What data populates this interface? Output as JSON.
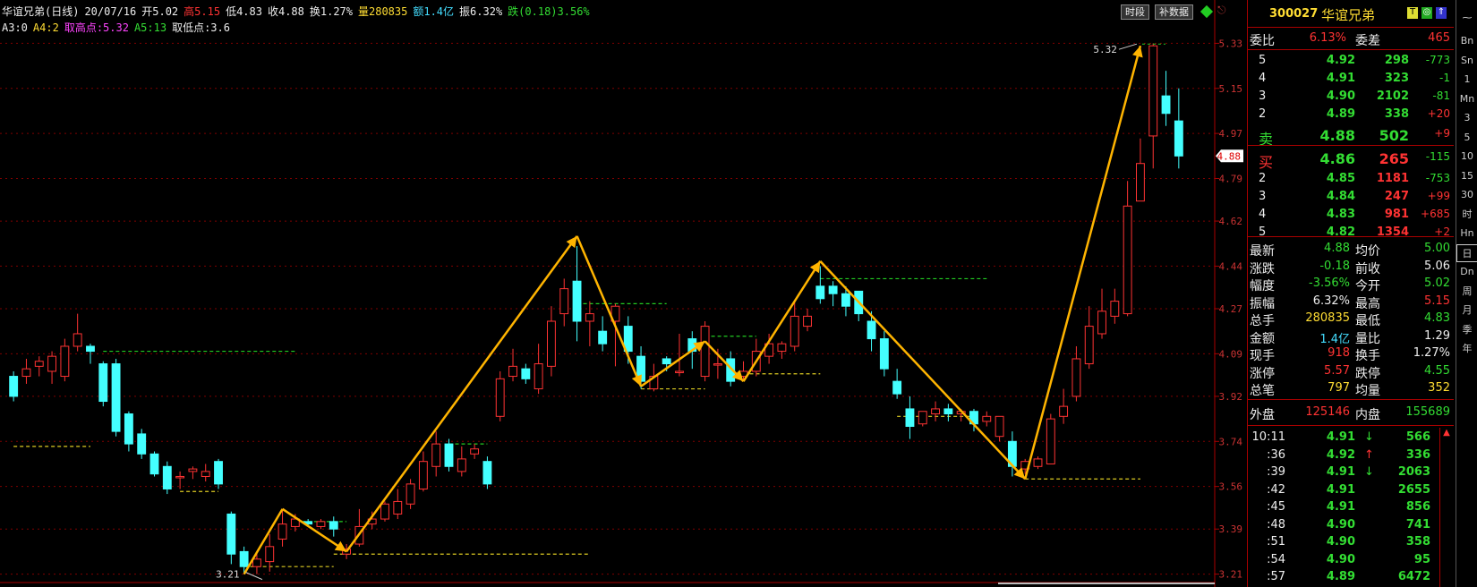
{
  "header": {
    "name": "华谊兄弟(日线)",
    "date": "20/07/16",
    "open": "开5.02",
    "high": "高5.15",
    "low": "低4.83",
    "close": "收4.88",
    "turnover": "换1.27%",
    "volume": "量280835",
    "amount": "额1.4亿",
    "amplitude": "振6.32%",
    "change": "跌(0.18)3.56%"
  },
  "indicator": {
    "a3": "A3:0",
    "a4": "A4:2",
    "high_pt": "取高点:5.32",
    "a5": "A5:13",
    "low_pt": "取低点:3.6"
  },
  "buttons": {
    "timeshare": "时段",
    "fill_data": "补数据"
  },
  "colors": {
    "up": "#ff3333",
    "down": "#44ffff",
    "arrow": "#ffb400",
    "grid": "#800000"
  },
  "chart_data": {
    "type": "candlestick",
    "ylim": [
      3.18,
      5.36
    ],
    "y_ticks": [
      "5.33",
      "5.15",
      "4.97",
      "4.79",
      "4.62",
      "4.44",
      "4.27",
      "4.09",
      "3.92",
      "3.74",
      "3.56",
      "3.39",
      "3.21"
    ],
    "current_price_tag": "4.88",
    "max_label": "5.32",
    "min_label": "3.21",
    "candles": [
      [
        4.0,
        3.92,
        4.02,
        3.9
      ],
      [
        4.0,
        4.03,
        4.07,
        3.97
      ],
      [
        4.04,
        4.06,
        4.08,
        4.0
      ],
      [
        4.02,
        4.08,
        4.1,
        3.97
      ],
      [
        4.0,
        4.12,
        4.15,
        3.98
      ],
      [
        4.12,
        4.17,
        4.25,
        4.1
      ],
      [
        4.12,
        4.1,
        4.13,
        4.05
      ],
      [
        4.05,
        3.9,
        4.06,
        3.88
      ],
      [
        4.05,
        3.78,
        4.07,
        3.76
      ],
      [
        3.85,
        3.73,
        3.86,
        3.7
      ],
      [
        3.77,
        3.69,
        3.79,
        3.67
      ],
      [
        3.69,
        3.61,
        3.7,
        3.6
      ],
      [
        3.64,
        3.55,
        3.66,
        3.53
      ],
      [
        3.6,
        3.6,
        3.62,
        3.55
      ],
      [
        3.62,
        3.63,
        3.64,
        3.59
      ],
      [
        3.6,
        3.62,
        3.65,
        3.58
      ],
      [
        3.66,
        3.57,
        3.67,
        3.55
      ],
      [
        3.45,
        3.29,
        3.46,
        3.25
      ],
      [
        3.3,
        3.24,
        3.32,
        3.21
      ],
      [
        3.24,
        3.27,
        3.3,
        3.21
      ],
      [
        3.26,
        3.32,
        3.37,
        3.22
      ],
      [
        3.35,
        3.41,
        3.47,
        3.32
      ],
      [
        3.4,
        3.43,
        3.45,
        3.38
      ],
      [
        3.42,
        3.41,
        3.43,
        3.4
      ],
      [
        3.4,
        3.42,
        3.43,
        3.39
      ],
      [
        3.42,
        3.39,
        3.44,
        3.36
      ],
      [
        3.29,
        3.31,
        3.33,
        3.27
      ],
      [
        3.33,
        3.4,
        3.47,
        3.32
      ],
      [
        3.41,
        3.43,
        3.46,
        3.39
      ],
      [
        3.43,
        3.49,
        3.5,
        3.42
      ],
      [
        3.45,
        3.5,
        3.55,
        3.43
      ],
      [
        3.49,
        3.57,
        3.59,
        3.47
      ],
      [
        3.55,
        3.66,
        3.7,
        3.54
      ],
      [
        3.64,
        3.73,
        3.78,
        3.6
      ],
      [
        3.73,
        3.64,
        3.75,
        3.62
      ],
      [
        3.62,
        3.67,
        3.72,
        3.6
      ],
      [
        3.69,
        3.71,
        3.73,
        3.67
      ],
      [
        3.66,
        3.57,
        3.68,
        3.55
      ],
      [
        3.84,
        3.99,
        4.02,
        3.82
      ],
      [
        4.0,
        4.04,
        4.11,
        3.98
      ],
      [
        4.03,
        3.99,
        4.05,
        3.97
      ],
      [
        3.95,
        4.05,
        4.13,
        3.93
      ],
      [
        4.04,
        4.22,
        4.28,
        4.0
      ],
      [
        4.25,
        4.35,
        4.39,
        4.2
      ],
      [
        4.38,
        4.22,
        4.52,
        4.14
      ],
      [
        4.22,
        4.25,
        4.3,
        4.12
      ],
      [
        4.18,
        4.13,
        4.24,
        4.1
      ],
      [
        4.22,
        4.28,
        4.29,
        4.04
      ],
      [
        4.2,
        4.1,
        4.24,
        4.05
      ],
      [
        4.08,
        3.98,
        4.12,
        3.95
      ],
      [
        3.95,
        4.0,
        4.05,
        3.94
      ],
      [
        4.07,
        4.05,
        4.08,
        4.02
      ],
      [
        4.02,
        4.02,
        4.17,
        4.0
      ],
      [
        4.15,
        4.1,
        4.18,
        4.03
      ],
      [
        4.0,
        4.2,
        4.22,
        3.98
      ],
      [
        4.05,
        4.05,
        4.11,
        3.99
      ],
      [
        4.07,
        3.98,
        4.1,
        3.96
      ],
      [
        4.0,
        4.02,
        4.06,
        3.98
      ],
      [
        4.02,
        4.1,
        4.15,
        4.0
      ],
      [
        4.08,
        4.13,
        4.17,
        4.05
      ],
      [
        4.1,
        4.13,
        4.14,
        4.07
      ],
      [
        4.12,
        4.24,
        4.3,
        4.1
      ],
      [
        4.2,
        4.24,
        4.27,
        4.18
      ],
      [
        4.36,
        4.31,
        4.44,
        4.29
      ],
      [
        4.36,
        4.33,
        4.38,
        4.28
      ],
      [
        4.33,
        4.28,
        4.36,
        4.24
      ],
      [
        4.34,
        4.25,
        4.33,
        4.22
      ],
      [
        4.22,
        4.15,
        4.26,
        4.1
      ],
      [
        4.15,
        4.03,
        4.18,
        4.0
      ],
      [
        3.98,
        3.93,
        4.03,
        3.91
      ],
      [
        3.87,
        3.8,
        3.92,
        3.75
      ],
      [
        3.81,
        3.86,
        3.86,
        3.8
      ],
      [
        3.85,
        3.87,
        3.9,
        3.82
      ],
      [
        3.87,
        3.85,
        3.89,
        3.82
      ],
      [
        3.85,
        3.86,
        3.87,
        3.82
      ],
      [
        3.86,
        3.81,
        3.87,
        3.78
      ],
      [
        3.82,
        3.84,
        3.86,
        3.8
      ],
      [
        3.76,
        3.84,
        3.84,
        3.74
      ],
      [
        3.74,
        3.64,
        3.78,
        3.6
      ],
      [
        3.63,
        3.66,
        3.67,
        3.61
      ],
      [
        3.64,
        3.67,
        3.68,
        3.63
      ],
      [
        3.65,
        3.83,
        3.85,
        3.65
      ],
      [
        3.84,
        3.88,
        3.95,
        3.81
      ],
      [
        3.92,
        4.07,
        4.12,
        3.9
      ],
      [
        4.05,
        4.2,
        4.28,
        4.03
      ],
      [
        4.17,
        4.26,
        4.35,
        4.15
      ],
      [
        4.24,
        4.3,
        4.35,
        4.21
      ],
      [
        4.25,
        4.68,
        4.78,
        4.24
      ],
      [
        4.7,
        4.85,
        4.95,
        4.7
      ],
      [
        4.96,
        5.32,
        5.33,
        4.83
      ],
      [
        5.12,
        5.05,
        5.22,
        5.0
      ],
      [
        5.02,
        4.88,
        5.15,
        4.83
      ]
    ],
    "pivots": [
      [
        21,
        3.47
      ],
      [
        26,
        3.3
      ],
      [
        44,
        4.56
      ],
      [
        49,
        3.96
      ],
      [
        54,
        4.14
      ],
      [
        57,
        3.98
      ],
      [
        63,
        4.46
      ],
      [
        79,
        3.59
      ],
      [
        88,
        5.32
      ]
    ],
    "dashed_levels": [
      {
        "y": 4.1,
        "from": 7,
        "to": 22,
        "c": "g"
      },
      {
        "y": 3.72,
        "from": 0,
        "to": 6,
        "c": "y"
      },
      {
        "y": 3.54,
        "from": 13,
        "to": 16,
        "c": "y"
      },
      {
        "y": 3.24,
        "from": 18,
        "to": 25,
        "c": "y"
      },
      {
        "y": 3.29,
        "from": 25,
        "to": 45,
        "c": "y"
      },
      {
        "y": 3.42,
        "from": 22,
        "to": 26,
        "c": "g"
      },
      {
        "y": 3.73,
        "from": 34,
        "to": 37,
        "c": "g"
      },
      {
        "y": 4.29,
        "from": 44,
        "to": 51,
        "c": "g"
      },
      {
        "y": 3.95,
        "from": 49,
        "to": 54,
        "c": "y"
      },
      {
        "y": 4.16,
        "from": 54,
        "to": 58,
        "c": "g"
      },
      {
        "y": 4.01,
        "from": 57,
        "to": 63,
        "c": "y"
      },
      {
        "y": 4.39,
        "from": 63,
        "to": 76,
        "c": "g"
      },
      {
        "y": 3.84,
        "from": 69,
        "to": 75,
        "c": "y"
      },
      {
        "y": 3.59,
        "from": 79,
        "to": 88,
        "c": "y"
      }
    ]
  },
  "quote": {
    "code": "300027",
    "name": "华谊兄弟",
    "wb_label": "委比",
    "wb_value": "6.13%",
    "wc_label": "委差",
    "wc_value": "465",
    "sells": [
      {
        "lvl": "5",
        "price": "4.92",
        "vol": "298",
        "chg": "-773"
      },
      {
        "lvl": "4",
        "price": "4.91",
        "vol": "323",
        "chg": "-1"
      },
      {
        "lvl": "3",
        "price": "4.90",
        "vol": "2102",
        "chg": "-81"
      },
      {
        "lvl": "2",
        "price": "4.89",
        "vol": "338",
        "chg": "+20"
      },
      {
        "lvl": "卖",
        "price": "4.88",
        "vol": "502",
        "chg": "+9"
      }
    ],
    "buys": [
      {
        "lvl": "买",
        "price": "4.86",
        "vol": "265",
        "chg": "-115"
      },
      {
        "lvl": "2",
        "price": "4.85",
        "vol": "1181",
        "chg": "-753"
      },
      {
        "lvl": "3",
        "price": "4.84",
        "vol": "247",
        "chg": "+99"
      },
      {
        "lvl": "4",
        "price": "4.83",
        "vol": "981",
        "chg": "+685"
      },
      {
        "lvl": "5",
        "price": "4.82",
        "vol": "1354",
        "chg": "+2"
      }
    ],
    "stats": [
      {
        "l1": "最新",
        "v1": "4.88",
        "c1": "green",
        "l2": "均价",
        "v2": "5.00",
        "c2": "green"
      },
      {
        "l1": "涨跌",
        "v1": "-0.18",
        "c1": "green",
        "l2": "前收",
        "v2": "5.06",
        "c2": "white"
      },
      {
        "l1": "幅度",
        "v1": "-3.56%",
        "c1": "green",
        "l2": "今开",
        "v2": "5.02",
        "c2": "green"
      },
      {
        "l1": "振幅",
        "v1": "6.32%",
        "c1": "white",
        "l2": "最高",
        "v2": "5.15",
        "c2": "red"
      },
      {
        "l1": "总手",
        "v1": "280835",
        "c1": "yellow",
        "l2": "最低",
        "v2": "4.83",
        "c2": "green"
      },
      {
        "l1": "金额",
        "v1": "1.4亿",
        "c1": "cyan",
        "l2": "量比",
        "v2": "1.29",
        "c2": "white"
      },
      {
        "l1": "现手",
        "v1": "918",
        "c1": "red",
        "l2": "换手",
        "v2": "1.27%",
        "c2": "white"
      },
      {
        "l1": "涨停",
        "v1": "5.57",
        "c1": "red",
        "l2": "跌停",
        "v2": "4.55",
        "c2": "green"
      },
      {
        "l1": "总笔",
        "v1": "797",
        "c1": "yellow",
        "l2": "均量",
        "v2": "352",
        "c2": "yellow"
      }
    ],
    "outer_label": "外盘",
    "outer_value": "125146",
    "inner_label": "内盘",
    "inner_value": "155689",
    "ticks": [
      {
        "t": "10:11",
        "p": "4.91",
        "d": "↓",
        "v": "566"
      },
      {
        "t": ":36",
        "p": "4.92",
        "d": "↑",
        "v": "336"
      },
      {
        "t": ":39",
        "p": "4.91",
        "d": "↓",
        "v": "2063"
      },
      {
        "t": ":42",
        "p": "4.91",
        "d": "",
        "v": "2655"
      },
      {
        "t": ":45",
        "p": "4.91",
        "d": "",
        "v": "856"
      },
      {
        "t": ":48",
        "p": "4.90",
        "d": "",
        "v": "741"
      },
      {
        "t": ":51",
        "p": "4.90",
        "d": "",
        "v": "358"
      },
      {
        "t": ":54",
        "p": "4.90",
        "d": "",
        "v": "95"
      },
      {
        "t": ":57",
        "p": "4.89",
        "d": "",
        "v": "6472"
      }
    ]
  },
  "sidebar": [
    "Bn",
    "Sn",
    "1",
    "Mn",
    "3",
    "5",
    "10",
    "15",
    "30",
    "时",
    "Hn",
    "日",
    "Dn",
    "周",
    "月",
    "季",
    "年"
  ]
}
